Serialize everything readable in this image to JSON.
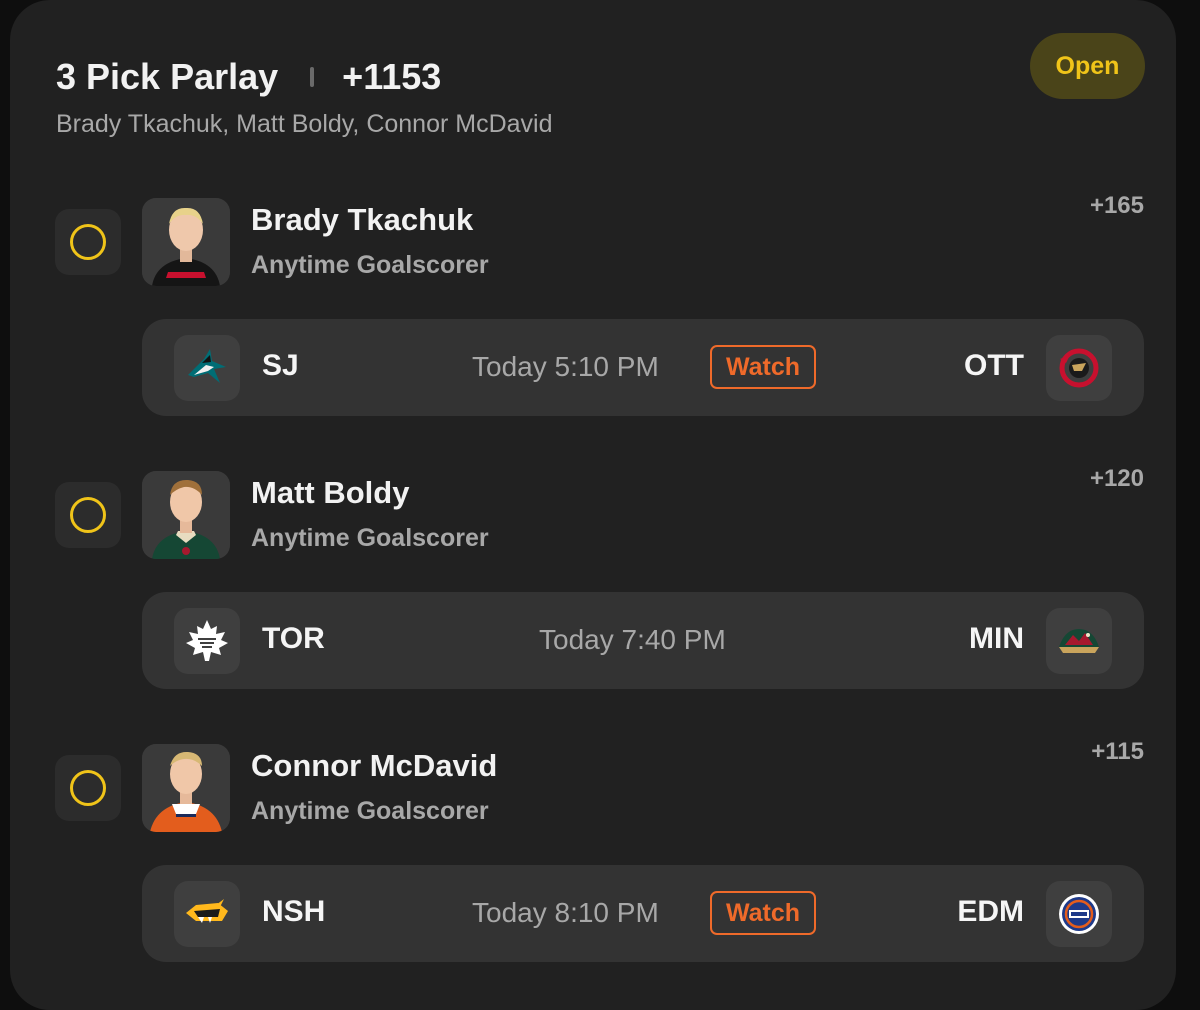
{
  "header": {
    "title": "3 Pick Parlay",
    "odds": "+1153",
    "subtitle": "Brady Tkachuk, Matt Boldy, Connor McDavid",
    "status": "Open"
  },
  "legs": [
    {
      "player": "Brady Tkachuk",
      "market": "Anytime Goalscorer",
      "odds": "+165",
      "game": {
        "away": "SJ",
        "home": "OTT",
        "time": "Today 5:10 PM",
        "watch": "Watch"
      }
    },
    {
      "player": "Matt Boldy",
      "market": "Anytime Goalscorer",
      "odds": "+120",
      "game": {
        "away": "TOR",
        "home": "MIN",
        "time": "Today 7:40 PM",
        "watch": null
      }
    },
    {
      "player": "Connor McDavid",
      "market": "Anytime Goalscorer",
      "odds": "+115",
      "game": {
        "away": "NSH",
        "home": "EDM",
        "time": "Today 8:10 PM",
        "watch": "Watch"
      }
    }
  ],
  "colors": {
    "accent_yellow": "#f0c419",
    "watch_orange": "#ef6a2a",
    "card_bg": "#212121",
    "game_bg": "#333333"
  },
  "icons": {
    "leg_0_away": "sharks-logo-icon",
    "leg_0_home": "senators-logo-icon",
    "leg_1_away": "maple-leafs-logo-icon",
    "leg_1_home": "wild-logo-icon",
    "leg_2_away": "predators-logo-icon",
    "leg_2_home": "oilers-logo-icon"
  }
}
